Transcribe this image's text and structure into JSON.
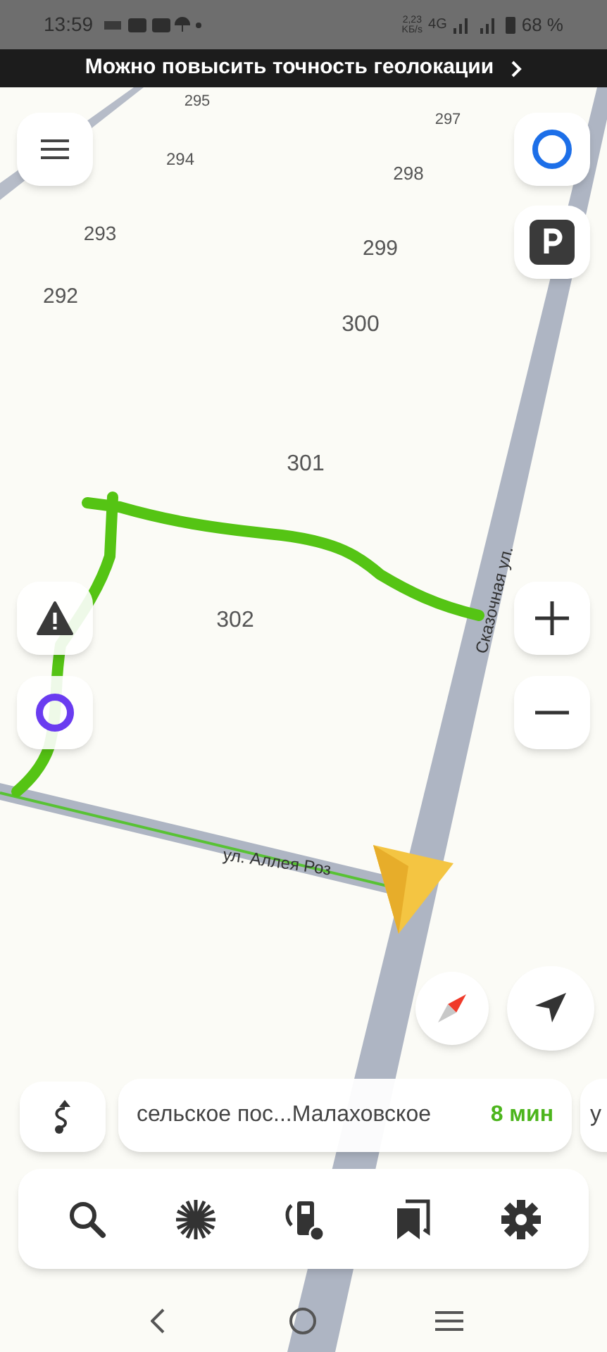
{
  "status_bar": {
    "time": "13:59",
    "speed_value": "2,23",
    "speed_unit": "KБ/s",
    "network": "4G",
    "battery": "68 %"
  },
  "banner": {
    "text": "Можно повысить точность геолокации"
  },
  "map": {
    "house_numbers": [
      {
        "label": "295"
      },
      {
        "label": "297"
      },
      {
        "label": "294"
      },
      {
        "label": "298"
      },
      {
        "label": "293"
      },
      {
        "label": "299"
      },
      {
        "label": "292"
      },
      {
        "label": "300"
      },
      {
        "label": "301"
      },
      {
        "label": "302"
      }
    ],
    "streets": [
      {
        "name": "Сказочная ул."
      },
      {
        "name": "ул. Аллея Роз"
      }
    ]
  },
  "route_bar": {
    "destination": "сельское пос...Малаховское",
    "eta": "8 мин",
    "next_card": "у"
  }
}
